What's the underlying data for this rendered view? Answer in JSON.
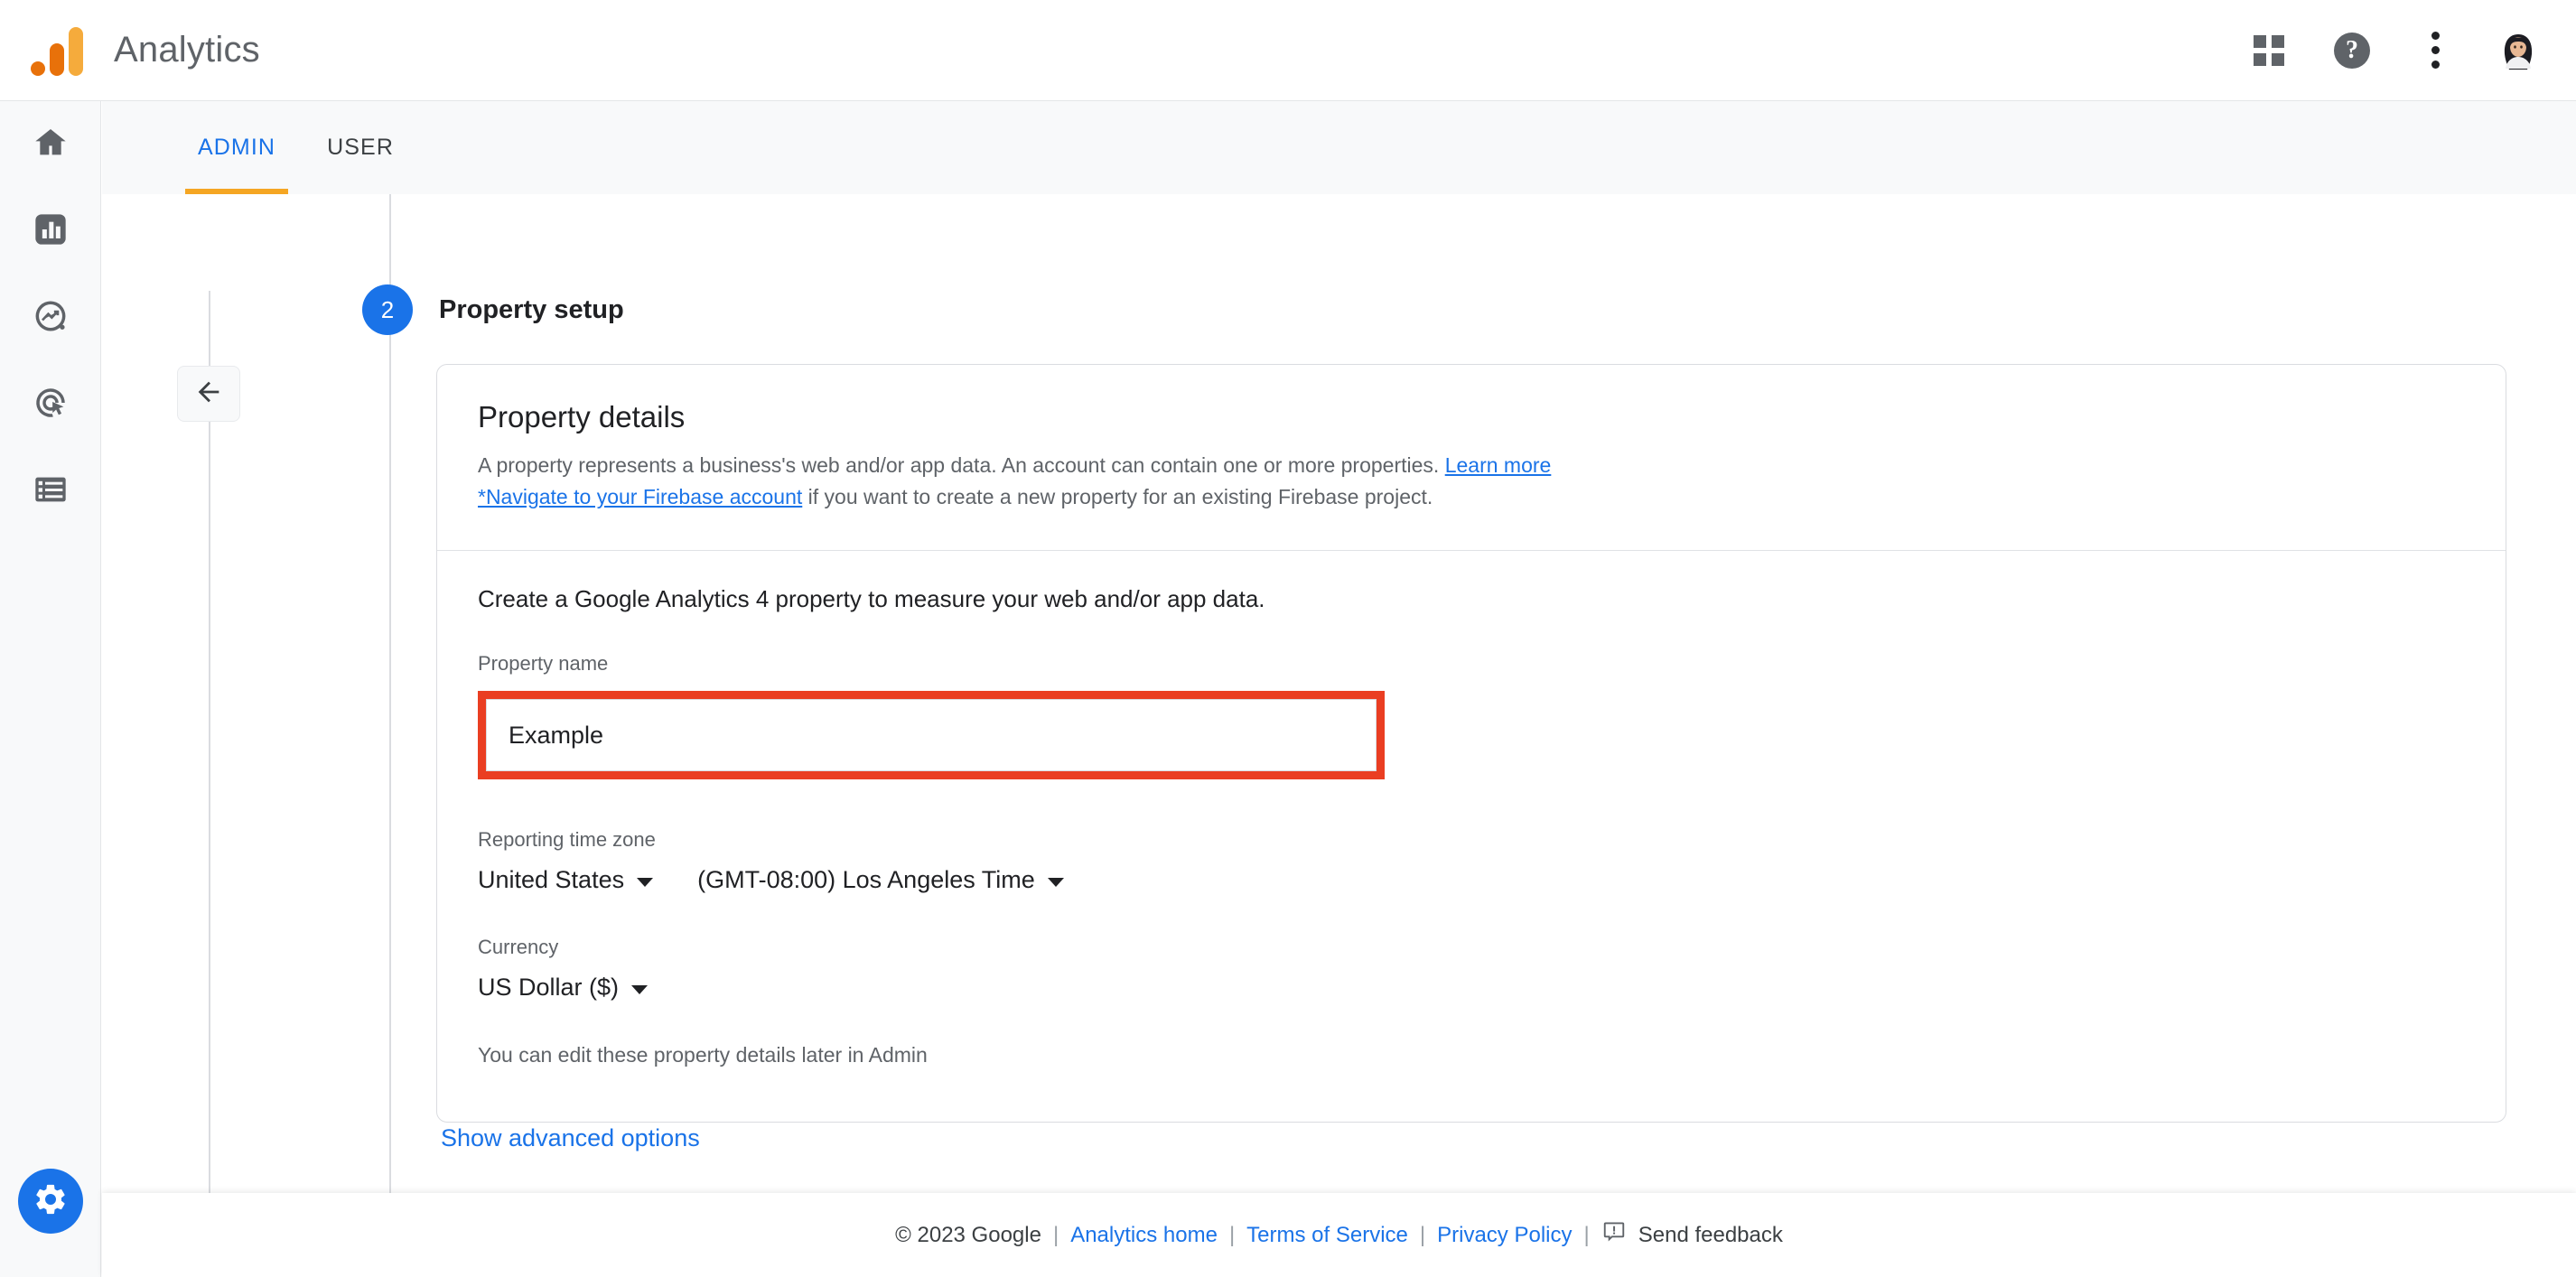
{
  "topbar": {
    "brand": "Analytics",
    "logo_colors": {
      "dot": "#E8710A",
      "mid": "#E8710A",
      "tall": "#F5AB3C"
    },
    "apps_icon": "apps-grid-icon",
    "help_icon": "help-icon",
    "help_glyph": "?",
    "more_icon": "more-vert-icon",
    "avatar_icon": "user-avatar"
  },
  "rail": {
    "items": [
      {
        "icon": "home-icon",
        "name": "sidebar-item-home"
      },
      {
        "icon": "reports-bar-chart-icon",
        "name": "sidebar-item-reports"
      },
      {
        "icon": "explore-trending-icon",
        "name": "sidebar-item-explore"
      },
      {
        "icon": "advertising-target-icon",
        "name": "sidebar-item-advertising"
      },
      {
        "icon": "configure-list-icon",
        "name": "sidebar-item-configure"
      }
    ],
    "settings_icon": "gear-icon",
    "settings_color": "#1a73e8"
  },
  "tabs": [
    {
      "label": "ADMIN",
      "active": true
    },
    {
      "label": "USER",
      "active": false
    }
  ],
  "tab_indicator_color": "#F5A623",
  "back_button": {
    "icon": "arrow-left-icon"
  },
  "step": {
    "number": "2",
    "title": "Property setup",
    "badge_color": "#1a73e8"
  },
  "card": {
    "heading": "Property details",
    "description_part1": "A property represents a business's web and/or app data. An account can contain one or more properties. ",
    "learn_more_link": "Learn more",
    "firebase_link": "*Navigate to your Firebase account",
    "description_part2": " if you want to create a new property for an existing Firebase project.",
    "lead": "Create a Google Analytics 4 property to measure your web and/or app data.",
    "property_name_label": "Property name",
    "property_name_value": "Example",
    "property_name_placeholder": "Property name",
    "highlight_color": "#EA3E22",
    "timezone_label": "Reporting time zone",
    "timezone_country": "United States",
    "timezone_zone": "(GMT-08:00) Los Angeles Time",
    "currency_label": "Currency",
    "currency_value": "US Dollar ($)",
    "note": "You can edit these property details later in Admin"
  },
  "advanced_options_link": "Show advanced options",
  "footer": {
    "copyright": "© 2023 Google",
    "analytics_home": "Analytics home",
    "terms": "Terms of Service",
    "privacy": "Privacy Policy",
    "feedback": "Send feedback",
    "feedback_icon": "feedback-bubble-icon",
    "separator": "|"
  }
}
